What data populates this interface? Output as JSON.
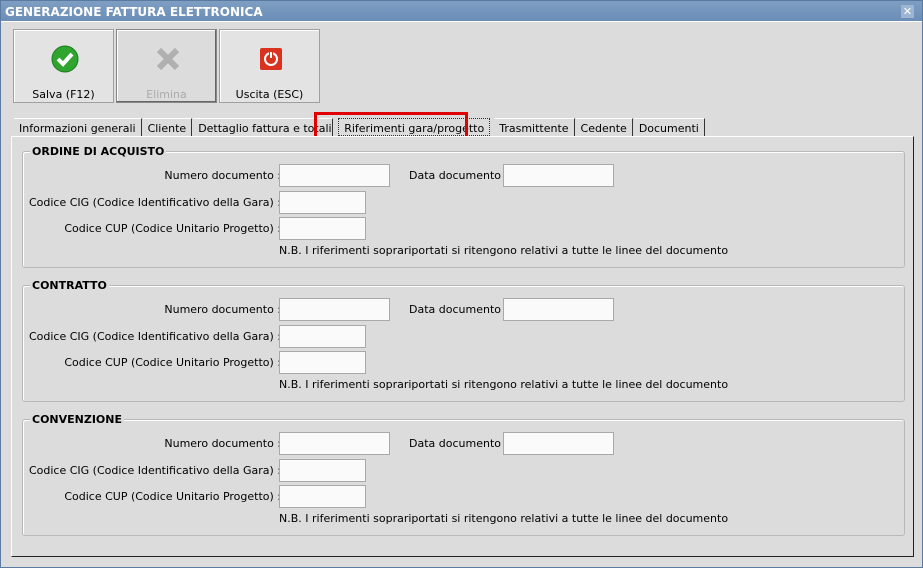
{
  "window": {
    "title": "GENERAZIONE FATTURA ELETTRONICA",
    "close": "✕"
  },
  "toolbar": {
    "save": "Salva (F12)",
    "delete": "Elimina",
    "exit": "Uscita (ESC)"
  },
  "tabs": [
    "Informazioni generali",
    "Cliente",
    "Dettaglio fattura e totali IVA",
    "Riferimenti gara/progetto",
    "Trasmittente",
    "Cedente",
    "Documenti"
  ],
  "labels": {
    "numero": "Numero documento :",
    "data": "Data documento :",
    "cig": "Codice CIG (Codice Identificativo della Gara) :",
    "cup": "Codice CUP (Codice Unitario Progetto) :",
    "nb": "N.B. I riferimenti soprariportati si ritengono relativi a tutte le linee del documento"
  },
  "groups": [
    {
      "title": "ORDINE DI ACQUISTO",
      "numero": "",
      "data": "",
      "cig": "",
      "cup": ""
    },
    {
      "title": "CONTRATTO",
      "numero": "",
      "data": "",
      "cig": "",
      "cup": ""
    },
    {
      "title": "CONVENZIONE",
      "numero": "",
      "data": "",
      "cig": "",
      "cup": ""
    }
  ]
}
